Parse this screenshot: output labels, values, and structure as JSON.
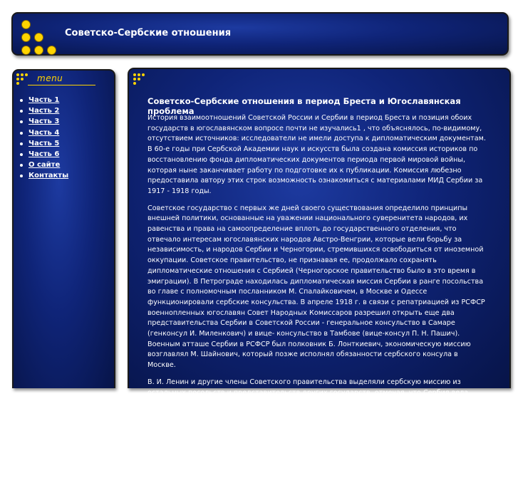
{
  "header": {
    "site_title": "Советско-Сербские отношения",
    "logo_icon": "yellow-dots-logo-icon"
  },
  "sidebar": {
    "heading": "menu",
    "items": [
      {
        "label": "Часть 1"
      },
      {
        "label": "Часть 2"
      },
      {
        "label": "Часть 3"
      },
      {
        "label": "Часть 4"
      },
      {
        "label": "Часть 5"
      },
      {
        "label": "Часть 6"
      },
      {
        "label": "О сайте"
      },
      {
        "label": "Контакты"
      }
    ]
  },
  "content": {
    "title": "Советско-Сербские отношения в период Бреста и Югославянская проблема",
    "paragraphs": [
      "История взаимоотношений Советской России и Сербии в период Бреста и позиция обоих государств в югославянском вопросе почти не изучались1 , что объяснялось, по-видимому, отсутствием источников: исследователи не имели доступа к дипломатическим документам. В 60-е годы при Сербской Академии наук и искусств была создана комиссия историков по восстановлению фонда дипломатических документов периода первой мировой войны, которая ныне заканчивает работу по подготовке их к публикации. Комиссия любезно предоставила автору этих строк возможность ознакомиться с материалами МИД Сербии за 1917 - 1918 годы.",
      "Советское государство с первых же дней своего существования определило принципы внешней политики, основанные на уважении национального суверенитета народов, их равенства и права на самоопределение вплоть до государственного отделения, что отвечало интересам югославянских народов Австро-Венгрии, которые вели борьбу за независимость, и народов Сербии и Черногории, стремившихся освободиться от иноземной оккупации. Советское правительство, не признавая ее, продолжало сохранять дипломатические отношения с Сербией (Черногорское правительство было в это время в эмиграции). В Петрограде находилась дипломатическая миссия Сербии в ранге посольства во главе с полномочным посланником М. Спалайковичем, в Москве и Одессе функционировали сербские консульства. В апреле 1918 г. в связи с репатриацией из РСФСР военнопленных югославян Совет Народных Комиссаров разрешил открыть еще два представительства Сербии в Советской России - генеральное консульство в Самаре (генконсул И. Миленкович) и вице- консульство в Тамбове (вице-консул П. Н. Пашич). Военным атташе Сербии в РСФСР был полковник Б. Лонткиевич, экономическую миссию возглавлял М. Шайнович, который позже исполнял обязанности сербского консула в Москве.",
      "В. И. Ленин и другие члены Советского правительства выделяли сербскую миссию из остальных посольств и представительств других государств, отмечая, что Сербия вела оборонительную войну против агрессии, защищая свою независимость2 . Интересны воспоминания сербских дипломатов - посланника М. Спалайковича и специального эмиссара председателя Совета министров Сербии Н. Пашича в Советской России Р. Йовановича об их встречах с В. И. Лениным. М. Спалайкович писал, что во время беседы с В. И, Лениным 1 января 1918 г. в Смольном руководитель Советского государства решительно осудил агрессию коалиции центральных держав против Сербии и Черногории и дал высокую"
    ]
  }
}
